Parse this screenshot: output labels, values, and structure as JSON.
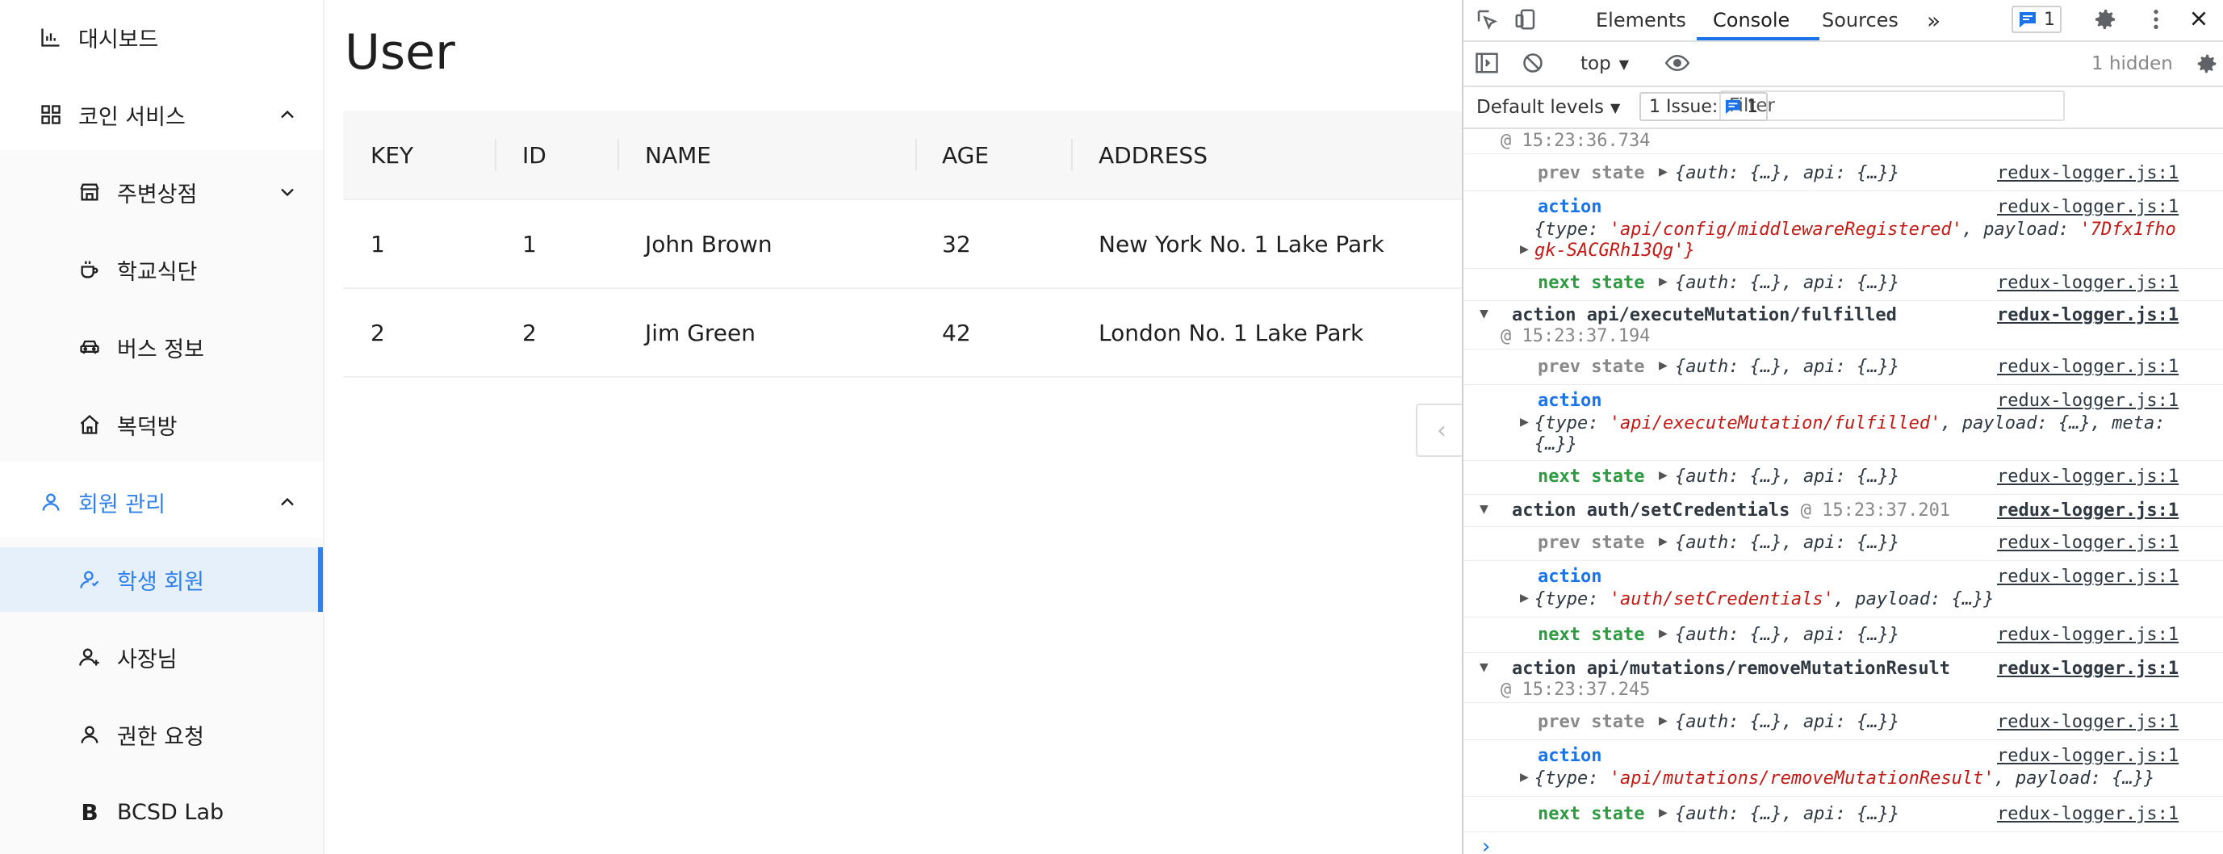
{
  "sidebar": {
    "items": [
      {
        "label": "대시보드",
        "icon": "bar-chart-icon"
      },
      {
        "label": "코인 서비스",
        "icon": "grid-icon"
      },
      {
        "label": "주변상점",
        "icon": "shop-icon"
      },
      {
        "label": "학교식단",
        "icon": "coffee-icon"
      },
      {
        "label": "버스 정보",
        "icon": "car-icon"
      },
      {
        "label": "복덕방",
        "icon": "home-icon"
      },
      {
        "label": "회원 관리",
        "icon": "user-icon"
      },
      {
        "label": "학생 회원",
        "icon": "student-icon"
      },
      {
        "label": "사장님",
        "icon": "user-add-icon"
      },
      {
        "label": "권한 요청",
        "icon": "user-icon"
      },
      {
        "label": "BCSD Lab",
        "icon": "bold-b-icon"
      }
    ]
  },
  "main": {
    "title": "User",
    "table": {
      "columns": [
        "KEY",
        "ID",
        "NAME",
        "AGE",
        "ADDRESS"
      ],
      "rows": [
        [
          "1",
          "1",
          "John Brown",
          "32",
          "New York No. 1 Lake Park"
        ],
        [
          "2",
          "2",
          "Jim Green",
          "42",
          "London No. 1 Lake Park"
        ]
      ]
    },
    "collapse_icon": "‹"
  },
  "devtools": {
    "tabs": [
      "Elements",
      "Console",
      "Sources"
    ],
    "more": "»",
    "message_count": "1",
    "context": "top",
    "filter_placeholder": "Filter",
    "hidden": "1 hidden",
    "levels": "Default levels",
    "issues_label": "1 Issue:",
    "issues_count": "1",
    "accent": "#1a73e8",
    "console": {
      "source": "redux-logger.js:1",
      "prev_label": "prev state",
      "next_label": "next state",
      "action_label": "action",
      "state_obj": "{auth: {…}, api: {…}}",
      "ts0": "@ 15:23:36.734",
      "g1_action": "{type: 'api/config/middlewareRegistered', payload: '7Dfx1fho",
      "g1_action2": "gk-SACGRh13Qg'}",
      "g2_title": "action api/executeMutation/fulfilled",
      "g2_ts": "@ 15:23:37.194",
      "g2_action": "{type: 'api/executeMutation/fulfilled', payload: {…}, meta:",
      "g2_action2": "{…}}",
      "g3_title": "action auth/setCredentials",
      "g3_ts": "@ 15:23:37.201",
      "g3_action": "{type: 'auth/setCredentials', payload: {…}}",
      "g4_title": "action api/mutations/removeMutationResult",
      "g4_ts": "@ 15:23:37.245",
      "g4_action": "{type: 'api/mutations/removeMutationResult', payload: {…}}",
      "prompt": "›"
    }
  }
}
